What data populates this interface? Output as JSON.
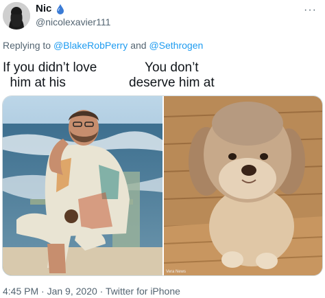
{
  "author": {
    "display_name": "Nic",
    "handle": "@nicolexavier111",
    "avatar": "silhouette-avatar",
    "badge_icon": "water-drop-emoji-icon"
  },
  "reply": {
    "prefix": "Replying to",
    "mention_1": "@BlakeRobPerry",
    "joiner": "and",
    "mention_2": "@Sethrogen"
  },
  "captions": {
    "left": "If you didn’t love\n  him at his",
    "right": "You don’t\ndeserve him at"
  },
  "media": {
    "left_image": "man-in-beach-chair-photo",
    "right_image": "fluffy-dog-photo",
    "credit": "Vera News"
  },
  "footer": {
    "time": "4:45 PM",
    "separator_1": "·",
    "date": "Jan 9, 2020",
    "separator_2": "·",
    "source": "Twitter for iPhone"
  },
  "colors": {
    "link": "#1d9bf0",
    "secondary_text": "#536471",
    "primary_text": "#0f1419"
  }
}
